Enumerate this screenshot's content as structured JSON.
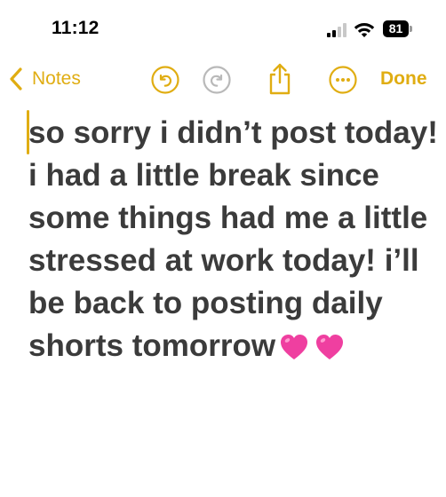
{
  "status_bar": {
    "time": "11:12",
    "battery_level": "81",
    "icons": [
      "signal-icon",
      "wifi-icon",
      "battery-icon"
    ]
  },
  "toolbar": {
    "back_label": "Notes",
    "done_label": "Done",
    "accent_color": "#e0ad12",
    "icons": [
      "chevron-left-icon",
      "undo-icon",
      "redo-icon",
      "share-icon",
      "more-icon"
    ]
  },
  "note": {
    "text": "so sorry i didn’t post today! i had a little break since some things had me a little stressed at work today! i’ll be back to posting daily shorts tomorrow",
    "emoji": [
      "pink-heart",
      "pink-heart"
    ],
    "text_color": "#3b3b3b"
  }
}
